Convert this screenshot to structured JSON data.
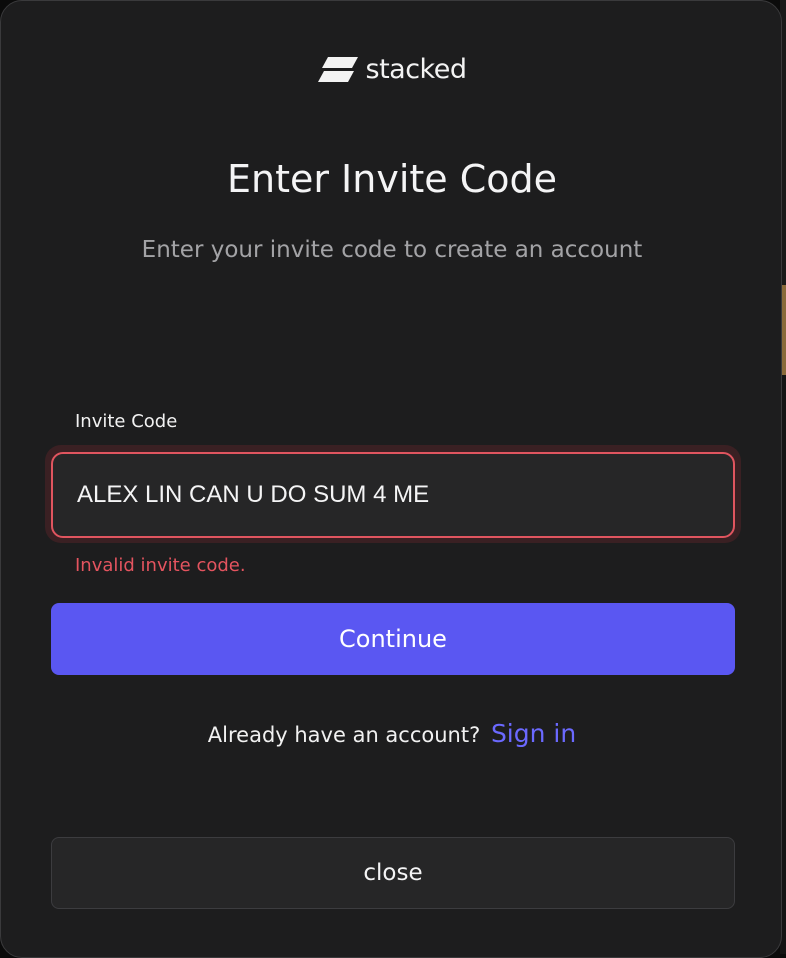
{
  "brand": {
    "name": "stacked",
    "logo_icon": "stacked-logo-icon"
  },
  "dialog": {
    "title": "Enter Invite Code",
    "subtitle": "Enter your invite code to create an account"
  },
  "form": {
    "invite_label": "Invite Code",
    "invite_value": "ALEX LIN CAN U DO SUM 4 ME",
    "error_message": "Invalid invite code.",
    "continue_label": "Continue"
  },
  "signin": {
    "prompt": "Already have an account?",
    "link_label": "Sign in"
  },
  "close_label": "close",
  "colors": {
    "background": "#1d1d1e",
    "accent": "#5a57f2",
    "link": "#6b69ff",
    "error": "#e4545f"
  }
}
